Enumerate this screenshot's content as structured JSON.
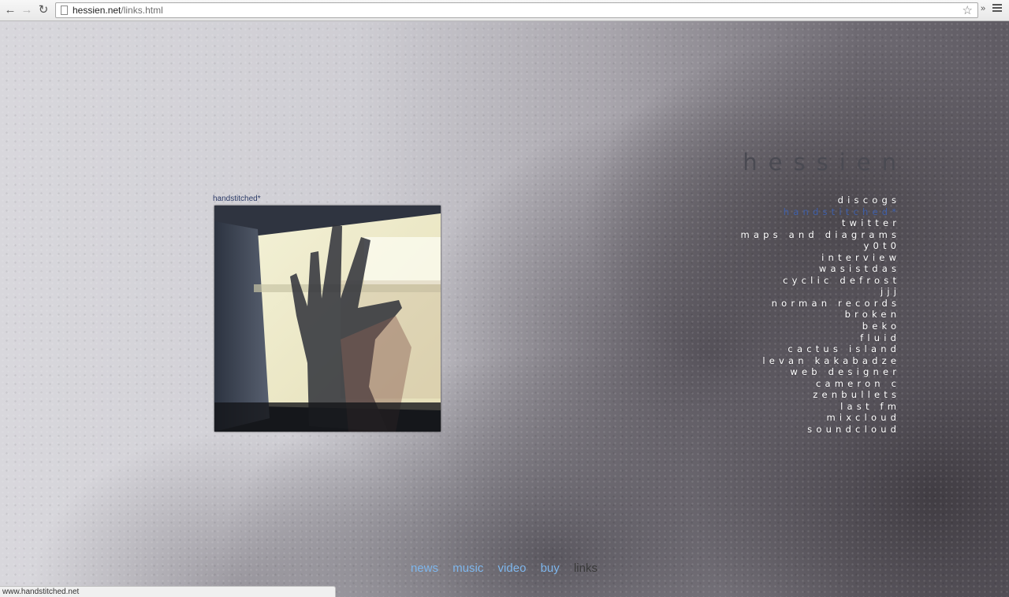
{
  "browser": {
    "url_host": "hessien.net",
    "url_path": "/links.html",
    "status_url": "www.handstitched.net"
  },
  "site": {
    "title": "hessien"
  },
  "album": {
    "label": "handstitched*"
  },
  "links": [
    {
      "label": "discogs",
      "active": false
    },
    {
      "label": "handstitched*",
      "active": true
    },
    {
      "label": "twitter",
      "active": false
    },
    {
      "label": "maps and diagrams",
      "active": false
    },
    {
      "label": "y0t0",
      "active": false
    },
    {
      "label": "interview",
      "active": false
    },
    {
      "label": "wasistdas",
      "active": false
    },
    {
      "label": "cyclic defrost",
      "active": false
    },
    {
      "label": "jjj",
      "active": false
    },
    {
      "label": "norman records",
      "active": false
    },
    {
      "label": "broken",
      "active": false
    },
    {
      "label": "beko",
      "active": false
    },
    {
      "label": "fluid",
      "active": false
    },
    {
      "label": "cactus island",
      "active": false
    },
    {
      "label": "levan kakabadze",
      "active": false
    },
    {
      "label": "web designer",
      "active": false
    },
    {
      "label": "cameron c",
      "active": false
    },
    {
      "label": "zenbullets",
      "active": false
    },
    {
      "label": "last fm",
      "active": false
    },
    {
      "label": "mixcloud",
      "active": false
    },
    {
      "label": "soundcloud",
      "active": false
    }
  ],
  "nav": {
    "news": "news",
    "music": "music",
    "video": "video",
    "buy": "buy",
    "links": "links"
  },
  "colors": {
    "link_default": "#ffffff",
    "link_active": "#3f5fa8",
    "nav_link": "#7eb6ec",
    "nav_current": "#3a3a3a"
  }
}
